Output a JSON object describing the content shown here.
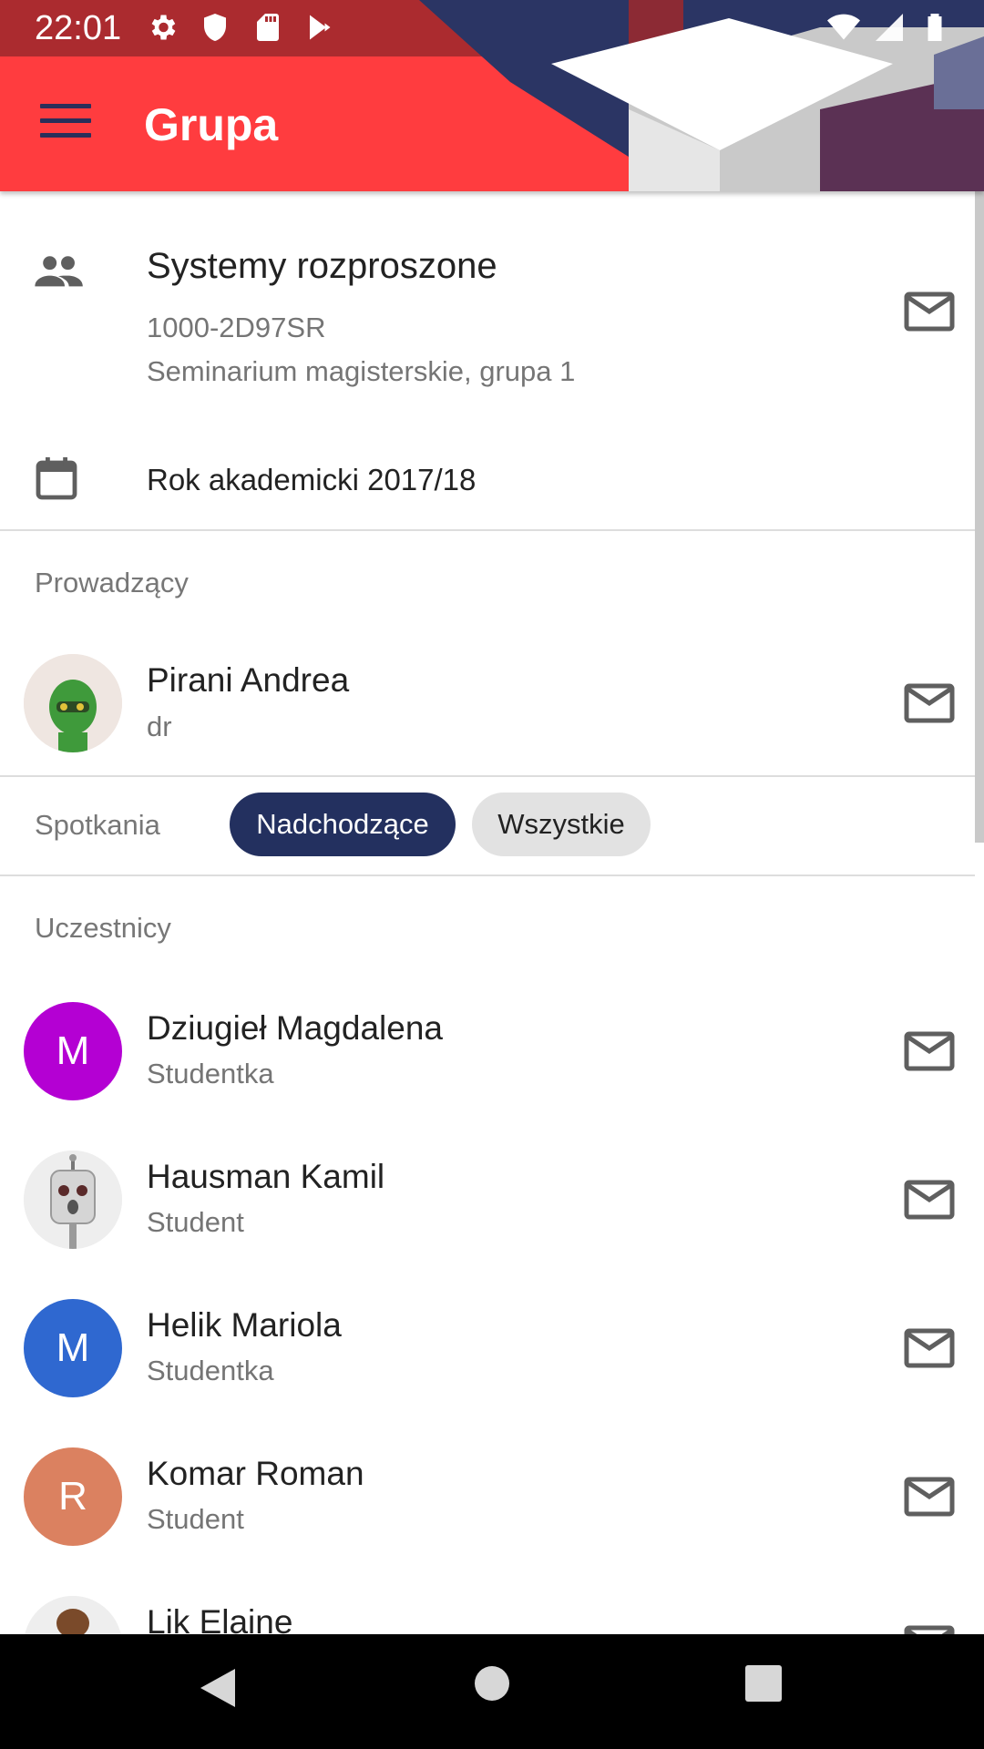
{
  "status_bar": {
    "time": "22:01"
  },
  "app_bar": {
    "title": "Grupa"
  },
  "group": {
    "name": "Systemy rozproszone",
    "code": "1000-2D97SR",
    "type": "Seminarium magisterskie, grupa 1",
    "year": "Rok akademicki 2017/18"
  },
  "teachers_section": {
    "label": "Prowadzący",
    "items": [
      {
        "name": "Pirani Andrea",
        "role": "dr"
      }
    ]
  },
  "meetings": {
    "label": "Spotkania",
    "chip_upcoming": "Nadchodzące",
    "chip_all": "Wszystkie"
  },
  "participants": {
    "label": "Uczestnicy",
    "items": [
      {
        "name": "Dziugieł Magdalena",
        "role": "Studentka",
        "initial": "M",
        "color": "#b400d3"
      },
      {
        "name": "Hausman Kamil",
        "role": "Student"
      },
      {
        "name": "Helik Mariola",
        "role": "Studentka",
        "initial": "M",
        "color": "#2f68d0"
      },
      {
        "name": "Komar Roman",
        "role": "Student",
        "initial": "R",
        "color": "#db8160"
      },
      {
        "name": "Lik Elaine"
      }
    ]
  },
  "colors": {
    "accent_red": "#ff3c3f",
    "navy": "#23305f"
  }
}
